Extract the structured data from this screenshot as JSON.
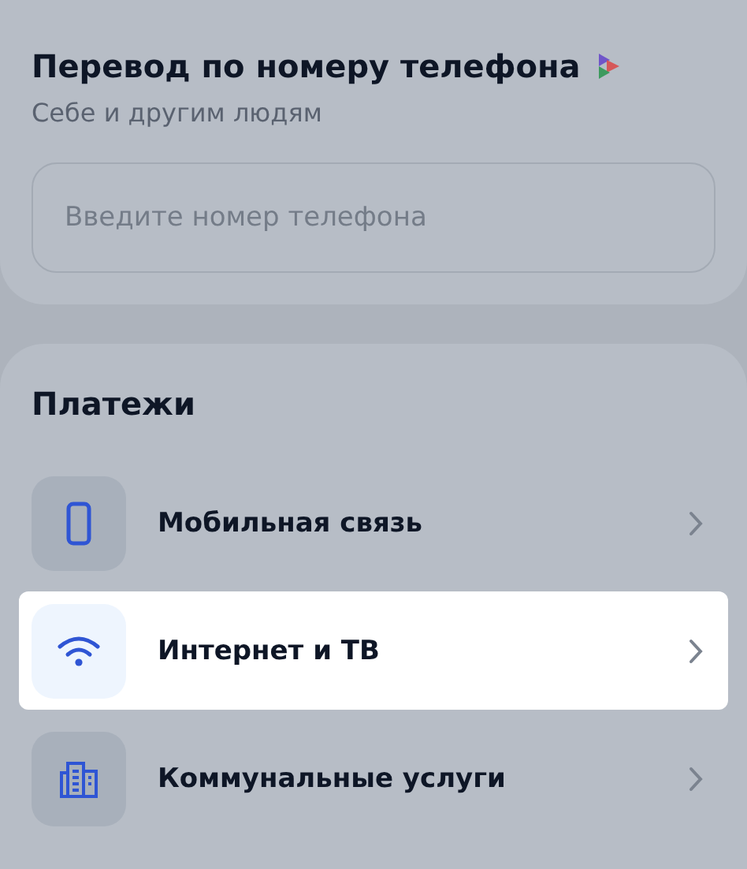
{
  "transfer": {
    "title": "Перевод по номеру телефона",
    "subtitle": "Себе и другим людям",
    "phone_field": {
      "placeholder": "Введите номер телефона"
    }
  },
  "payments": {
    "title": "Платежи",
    "items": [
      {
        "kind": "phone",
        "label": "Мобильная связь",
        "selected": false
      },
      {
        "kind": "wifi",
        "label": "Интернет и ТВ",
        "selected": true
      },
      {
        "kind": "building",
        "label": "Коммунальные услуги",
        "selected": false
      }
    ]
  }
}
